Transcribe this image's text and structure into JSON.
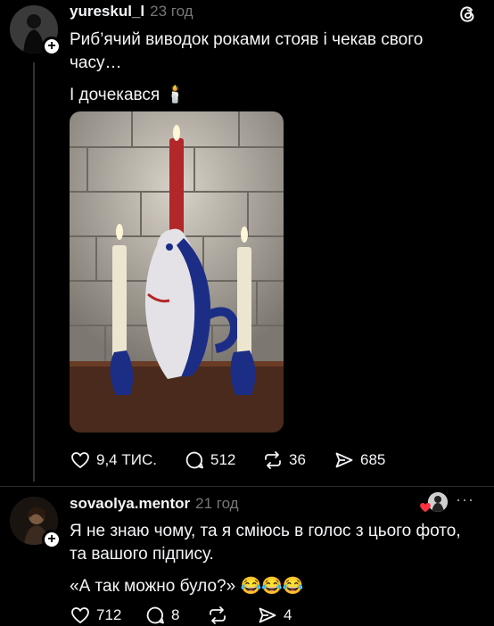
{
  "post": {
    "username": "yureskul_l",
    "time": "23 год",
    "text_line1": "Риб’ячий виводок роками стояв і чекав свого",
    "text_line2": "часу…",
    "text_line3": "І дочекався 🕯️",
    "likes": "9,4 ТИС.",
    "comments": "512",
    "reposts": "36",
    "shares": "685"
  },
  "reply": {
    "username": "sovaolya.mentor",
    "time": "21 год",
    "text_line1": "Я не знаю чому, та я сміюсь в голос з цього фото,",
    "text_line2": "та вашого підпису.",
    "text_line3": "«А так можно було?» 😂😂😂",
    "likes": "712",
    "comments": "8",
    "reposts": "",
    "shares": "4",
    "more_label": "···"
  }
}
